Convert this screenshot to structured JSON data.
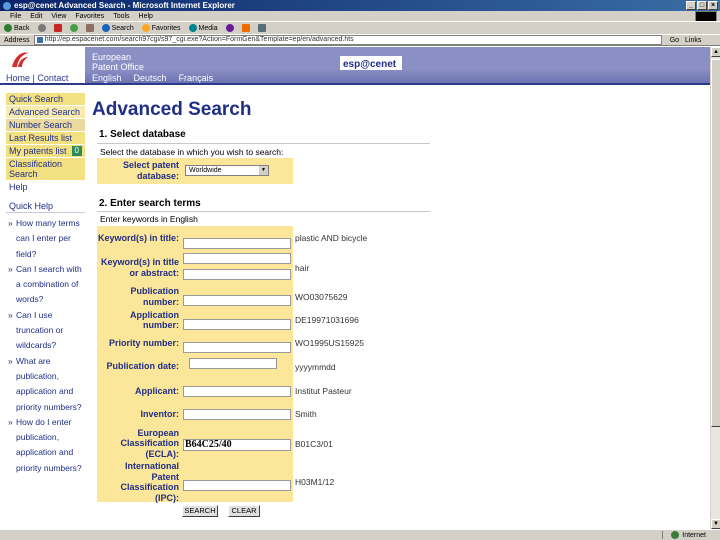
{
  "window": {
    "title": "esp@cenet Advanced Search - Microsoft Internet Explorer",
    "controls": [
      "_",
      "□",
      "×"
    ]
  },
  "menu": [
    "File",
    "Edit",
    "View",
    "Favorites",
    "Tools",
    "Help"
  ],
  "toolbar": {
    "back": "Back",
    "search": "Search",
    "favorites": "Favorites",
    "media": "Media"
  },
  "address": {
    "label": "Address",
    "url": "http://ep.espacenet.com/search97cgi/s97_cgi.exe?Action=FormGen&Template=ep/en/advanced.hts",
    "go": "Go",
    "links": "Links"
  },
  "status": {
    "zone": "Internet"
  },
  "header": {
    "home_contact": "Home | Contact",
    "org_line1": "European",
    "org_line2": "Patent Office",
    "langs": [
      "English",
      "Deutsch",
      "Français"
    ],
    "brand": "esp@cenet"
  },
  "nav": {
    "quick_search": "Quick Search",
    "advanced_search": "Advanced Search",
    "number_search": "Number Search",
    "last_results": "Last Results list",
    "my_patents": "My patents list",
    "my_patents_count": "0",
    "classification": "Classification Search",
    "help": "Help"
  },
  "quick_help": {
    "title": "Quick Help",
    "items": [
      "How many terms can I enter per field?",
      "Can I search with a combination of words?",
      "Can I use truncation or wildcards?",
      "What are publication, application and priority numbers?",
      "How do I enter publication, application and priority numbers?"
    ]
  },
  "main": {
    "title": "Advanced Search",
    "section1": {
      "title": "1. Select database",
      "desc": "Select the database in which you wish to search:",
      "label": "Select patent database:",
      "selected": "Worldwide"
    },
    "section2": {
      "title": "2. Enter search terms",
      "desc": "Enter keywords in English"
    },
    "fields": [
      {
        "label": "Keyword(s) in title:",
        "value": "",
        "example": "plastic AND bicycle"
      },
      {
        "label": "Keyword(s) in title or abstract:",
        "value": "",
        "example": "hair"
      },
      {
        "label": "Publication number:",
        "value": "",
        "example": "WO03075629"
      },
      {
        "label": "Application number:",
        "value": "",
        "example": "DE19971031696"
      },
      {
        "label": "Priority number:",
        "value": "",
        "example": "WO1995US15925"
      },
      {
        "label": "Publication date:",
        "value": "",
        "example": "yyyymmdd"
      },
      {
        "label": "Applicant:",
        "value": "",
        "example": "Institut Pasteur"
      },
      {
        "label": "Inventor:",
        "value": "",
        "example": "Smith"
      },
      {
        "label": "European Classification (ECLA):",
        "value": "B64C25/40",
        "example": "B01C3/01"
      },
      {
        "label": "International Patent Classification (IPC):",
        "value": "",
        "example": "H03M1/12"
      }
    ],
    "search_button": "SEARCH",
    "clear_button": "CLEAR"
  }
}
